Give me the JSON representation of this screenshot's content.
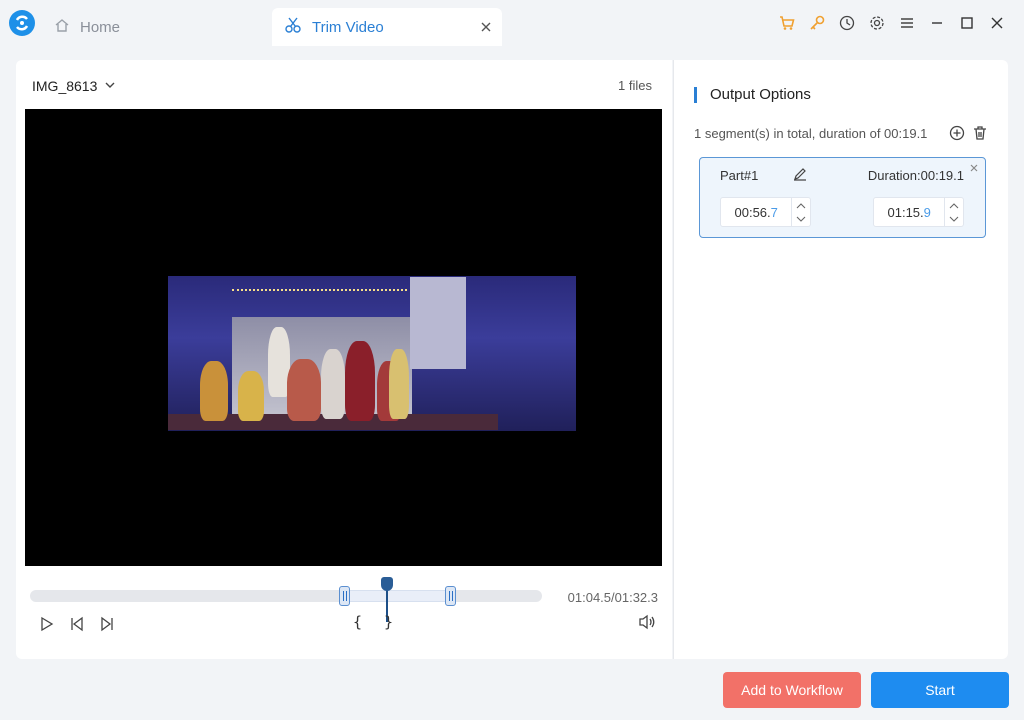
{
  "titlebar": {
    "tabs": [
      {
        "label": "Home",
        "icon": "home-icon"
      },
      {
        "label": "Trim Video",
        "icon": "scissors-icon"
      }
    ],
    "icons": [
      "cart-icon",
      "key-icon",
      "clock-icon",
      "gear-icon",
      "menu-icon",
      "minimize-icon",
      "maximize-icon",
      "close-icon"
    ],
    "colors": {
      "accent": "#2a7fd4",
      "cart": "#f0a030",
      "key": "#f0a030"
    }
  },
  "player": {
    "file_name": "IMG_8613",
    "files_count": "1 files",
    "time_readout": "01:04.5/01:32.3",
    "playhead_fraction": 0.698,
    "selection_start_fraction": 0.615,
    "selection_end_fraction": 0.821,
    "bracket_open": "{",
    "bracket_close": "}"
  },
  "output": {
    "title": "Output Options",
    "summary": "1 segment(s) in total, duration of 00:19.1",
    "segments": [
      {
        "part": "Part#1",
        "duration": "Duration:00:19.1",
        "start_main": "00:56.",
        "start_frac": "7",
        "end_main": "01:15.",
        "end_frac": "9"
      }
    ]
  },
  "buttons": {
    "workflow": "Add to Workflow",
    "start": "Start",
    "colors": {
      "workflow": "#f27168",
      "start": "#1e8cf0"
    }
  }
}
